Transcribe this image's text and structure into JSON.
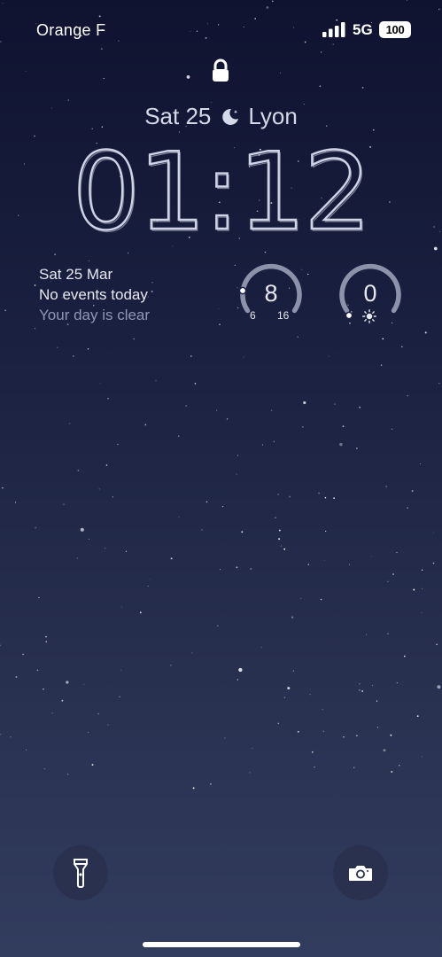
{
  "status_bar": {
    "carrier": "Orange F",
    "network": "5G",
    "battery": "100"
  },
  "lock_screen": {
    "date": "Sat 25",
    "city": "Lyon",
    "time": "01:12"
  },
  "calendar_widget": {
    "date": "Sat 25 Mar",
    "line1": "No events today",
    "line2": "Your day is clear"
  },
  "weather_widget": {
    "temperature": "8",
    "low": "6",
    "high": "16",
    "temperature_level": 0.2
  },
  "uv_widget": {
    "index": "0",
    "uv_level": 0.0,
    "icon": "sun-icon"
  },
  "quick_actions": {
    "left": "flashlight-icon",
    "right": "camera-icon"
  }
}
